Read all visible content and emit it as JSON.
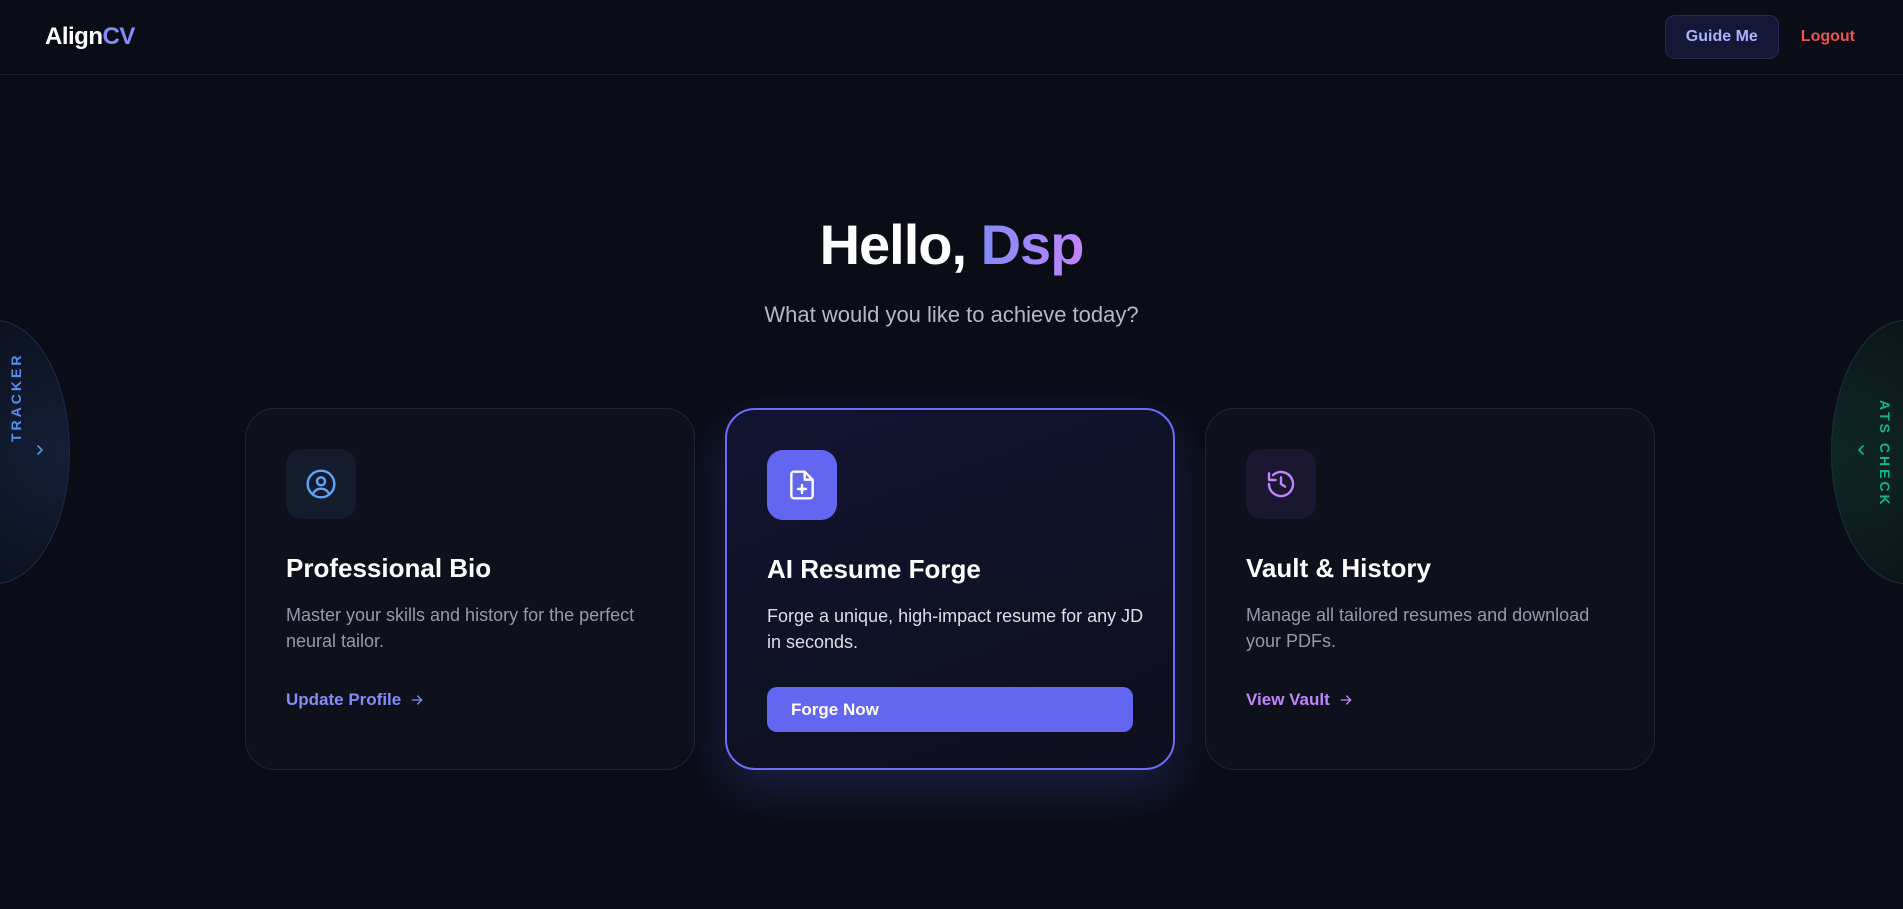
{
  "header": {
    "logo_part1": "Align",
    "logo_part2": "CV",
    "guide_label": "Guide Me",
    "logout_label": "Logout"
  },
  "hero": {
    "greeting": "Hello, ",
    "name": "Dsp",
    "subtitle": "What would you like to achieve today?"
  },
  "cards": [
    {
      "icon": "user-circle-icon",
      "title": "Professional Bio",
      "description": "Master your skills and history for the perfect neural tailor.",
      "action_label": "Update Profile"
    },
    {
      "icon": "file-plus-icon",
      "title": "AI Resume Forge",
      "description": "Forge a unique, high-impact resume for any JD in seconds.",
      "action_label": "Forge Now"
    },
    {
      "icon": "history-icon",
      "title": "Vault & History",
      "description": "Manage all tailored resumes and download your PDFs.",
      "action_label": "View Vault"
    }
  ],
  "side_tabs": {
    "left_label": "TRACKER",
    "right_label": "ATS CHECK"
  },
  "colors": {
    "background": "#0a0d16",
    "accent": "#6366f1",
    "accent_light": "#818cf8",
    "purple": "#c084fc",
    "logout": "#f05252",
    "tracker": "#5b8def",
    "ats": "#10b981"
  }
}
